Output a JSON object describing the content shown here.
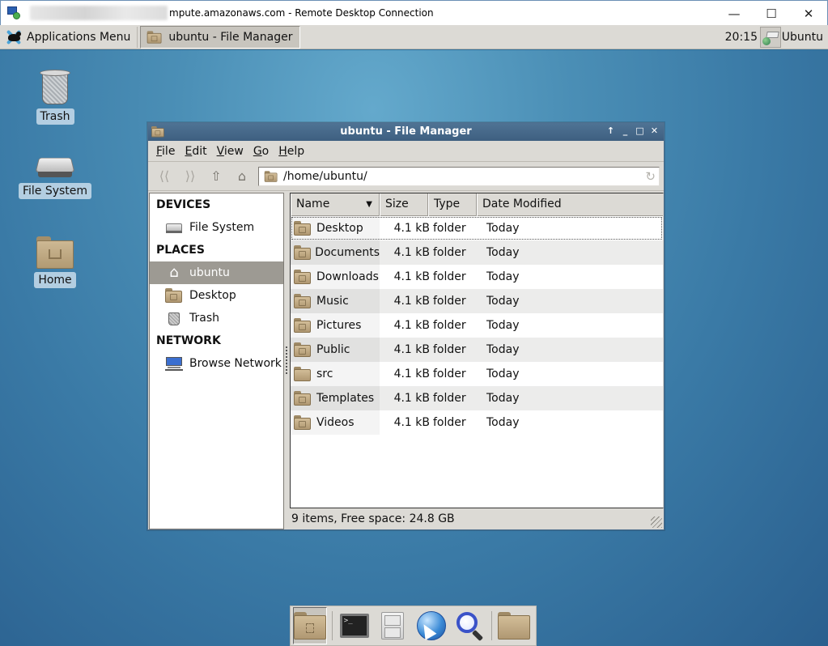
{
  "rdp_window": {
    "title": "mpute.amazonaws.com - Remote Desktop Connection",
    "controls": {
      "minimize": "—",
      "maximize": "☐",
      "close": "✕"
    }
  },
  "top_panel": {
    "applications_menu": "Applications Menu",
    "task_button": "ubuntu - File Manager",
    "clock": "20:15",
    "user": "Ubuntu"
  },
  "desktop_icons": [
    {
      "label": "Trash",
      "icon": "trash-icon"
    },
    {
      "label": "File System",
      "icon": "hard-drive-icon"
    },
    {
      "label": "Home",
      "icon": "home-folder-icon"
    }
  ],
  "file_manager": {
    "title": "ubuntu - File Manager",
    "window_controls": {
      "up": "↑",
      "minimize": "_",
      "maximize": "□",
      "close": "✕"
    },
    "menu": [
      {
        "label": "File",
        "mnemonic": "F",
        "rest": "ile"
      },
      {
        "label": "Edit",
        "mnemonic": "E",
        "rest": "dit"
      },
      {
        "label": "View",
        "mnemonic": "V",
        "rest": "iew"
      },
      {
        "label": "Go",
        "mnemonic": "G",
        "rest": "o"
      },
      {
        "label": "Help",
        "mnemonic": "H",
        "rest": "elp"
      }
    ],
    "toolbar": {
      "back": "⟨⟨",
      "forward": "⟩⟩",
      "up": "⇧",
      "home": "⌂",
      "path": "/home/ubuntu/",
      "reload": "↻"
    },
    "sidebar": {
      "sections": [
        {
          "heading": "DEVICES",
          "items": [
            {
              "label": "File System",
              "icon": "hard-drive-icon",
              "selected": false
            }
          ]
        },
        {
          "heading": "PLACES",
          "items": [
            {
              "label": "ubuntu",
              "icon": "home-icon",
              "selected": true
            },
            {
              "label": "Desktop",
              "icon": "desktop-folder-icon",
              "selected": false
            },
            {
              "label": "Trash",
              "icon": "trash-icon",
              "selected": false
            }
          ]
        },
        {
          "heading": "NETWORK",
          "items": [
            {
              "label": "Browse Network",
              "icon": "network-icon",
              "selected": false
            }
          ]
        }
      ]
    },
    "columns": {
      "name": "Name",
      "size": "Size",
      "type": "Type",
      "date": "Date Modified",
      "sort_indicator": "▼"
    },
    "files": [
      {
        "name": "Desktop",
        "size": "4.1 kB",
        "type": "folder",
        "date": "Today"
      },
      {
        "name": "Documents",
        "size": "4.1 kB",
        "type": "folder",
        "date": "Today"
      },
      {
        "name": "Downloads",
        "size": "4.1 kB",
        "type": "folder",
        "date": "Today"
      },
      {
        "name": "Music",
        "size": "4.1 kB",
        "type": "folder",
        "date": "Today"
      },
      {
        "name": "Pictures",
        "size": "4.1 kB",
        "type": "folder",
        "date": "Today"
      },
      {
        "name": "Public",
        "size": "4.1 kB",
        "type": "folder",
        "date": "Today"
      },
      {
        "name": "src",
        "size": "4.1 kB",
        "type": "folder",
        "date": "Today"
      },
      {
        "name": "Templates",
        "size": "4.1 kB",
        "type": "folder",
        "date": "Today"
      },
      {
        "name": "Videos",
        "size": "4.1 kB",
        "type": "folder",
        "date": "Today"
      }
    ],
    "status": "9 items, Free space: 24.8 GB"
  },
  "dock": {
    "items": [
      {
        "name": "show-desktop",
        "icon": "desktop-folder-icon",
        "active": true
      },
      {
        "name": "terminal",
        "icon": "terminal-icon",
        "active": false
      },
      {
        "name": "file-manager",
        "icon": "file-cabinet-icon",
        "active": false
      },
      {
        "name": "web-browser",
        "icon": "web-browser-icon",
        "active": false
      },
      {
        "name": "app-finder",
        "icon": "search-icon",
        "active": false
      },
      {
        "name": "folder",
        "icon": "folder-icon",
        "active": false
      }
    ],
    "terminal_prompt": ">_"
  },
  "colors": {
    "desktop_bg": "#3a7aa6",
    "titlebar_active": "#4a6d8f",
    "panel_bg": "#dcdad5",
    "selection": "#9d9a93",
    "folder": "#c4ae88"
  }
}
